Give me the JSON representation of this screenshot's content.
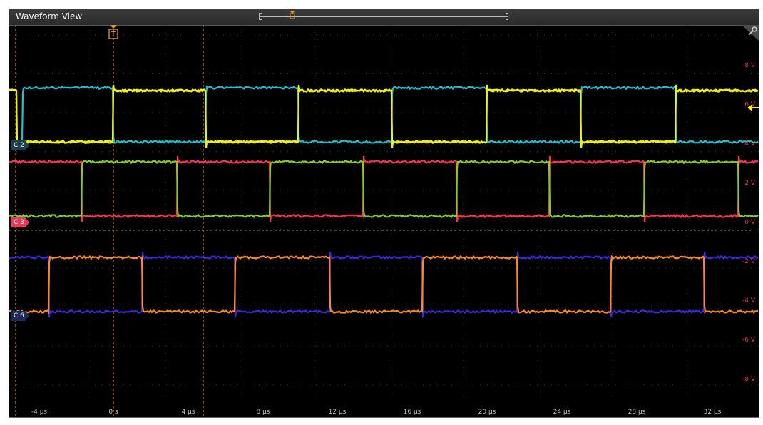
{
  "window": {
    "title": "Waveform View"
  },
  "trigger": {
    "marker_label": "T"
  },
  "channels": [
    {
      "id": "C2",
      "label": "C 2",
      "badge_color": "#1f3f4a",
      "colors": [
        "#f0f010",
        "#20c0d0"
      ]
    },
    {
      "id": "C3",
      "label": "C 3",
      "badge_color": "#e83a5a",
      "colors": [
        "#ff3355",
        "#88cc22"
      ]
    },
    {
      "id": "C6",
      "label": "C 6",
      "badge_color": "#1c2a55",
      "colors": [
        "#ff8c1a",
        "#3a2ad8"
      ]
    }
  ],
  "y_axis": {
    "labels": [
      "8 V",
      "6 V",
      "4 V",
      "2 V",
      "0 V",
      "-2 V",
      "-4 V",
      "-6 V",
      "-8 V"
    ],
    "color": "#e8394a"
  },
  "x_axis": {
    "labels": [
      "-4 µs",
      "0 s",
      "4 µs",
      "8 µs",
      "12 µs",
      "16 µs",
      "20 µs",
      "24 µs",
      "28 µs",
      "32 µs"
    ]
  },
  "icons": {
    "wrench": "wrench-icon",
    "trigger": "trigger-marker-icon",
    "level": "trigger-level-arrow-icon"
  },
  "colors": {
    "cursor": "#e39a2a",
    "grid": "#3a3a3a",
    "background": "#000000"
  }
}
